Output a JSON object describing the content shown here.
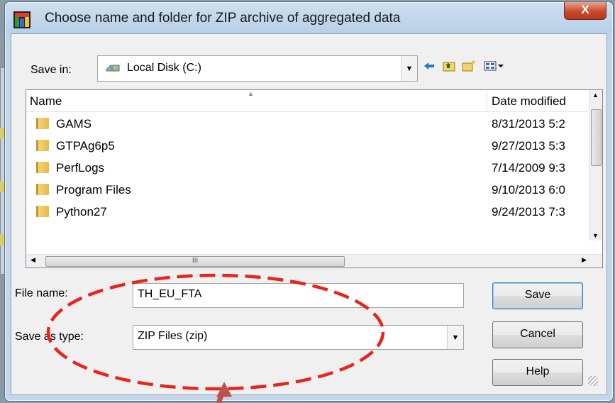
{
  "window": {
    "title": "Choose name and folder for ZIP archive of aggregated data",
    "close_label": "X"
  },
  "save_in": {
    "label": "Save in:",
    "value": "Local Disk (C:)"
  },
  "file_list": {
    "columns": [
      "Name",
      "Date modified"
    ],
    "rows": [
      {
        "name": "GAMS",
        "date": "8/31/2013 5:2"
      },
      {
        "name": "GTPAg6p5",
        "date": "9/27/2013 5:3"
      },
      {
        "name": "PerfLogs",
        "date": "7/14/2009 9:3"
      },
      {
        "name": "Program Files",
        "date": "9/10/2013 6:0"
      },
      {
        "name": "Python27",
        "date": "9/24/2013 7:3"
      }
    ],
    "hscroll_grip": "III"
  },
  "file_name": {
    "label": "File name:",
    "value": "TH_EU_FTA"
  },
  "save_as_type": {
    "label": "Save as type:",
    "value": "ZIP Files (zip)"
  },
  "buttons": {
    "save": "Save",
    "cancel": "Cancel",
    "help": "Help"
  },
  "toolbar_icons": [
    "back-icon",
    "up-folder-icon",
    "new-folder-icon",
    "view-menu-icon"
  ],
  "annotation": {
    "color": "#e8241c"
  }
}
